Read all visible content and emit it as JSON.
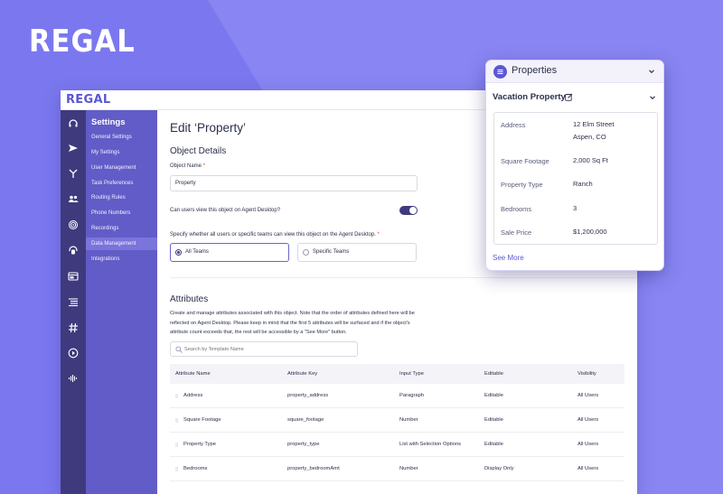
{
  "brand": {
    "name": "REGAL",
    "app_logo": "REGAL"
  },
  "colors": {
    "background": "#7b78ef",
    "accent": "#5b56d6",
    "rail": "#3f3a7e",
    "settings_nav": "#625cc8"
  },
  "rail_icons": [
    "headset-icon",
    "send-icon",
    "branch-icon",
    "team-icon",
    "fingerprint-icon",
    "support-icon",
    "browser-icon",
    "list-icon",
    "hash-icon",
    "play-icon",
    "waveform-icon"
  ],
  "settings_nav": {
    "title": "Settings",
    "items": [
      {
        "label": "General Settings"
      },
      {
        "label": "My Settings"
      },
      {
        "label": "User Management"
      },
      {
        "label": "Task Preferences"
      },
      {
        "label": "Routing Rules"
      },
      {
        "label": "Phone Numbers"
      },
      {
        "label": "Recordings"
      },
      {
        "label": "Data Management",
        "active": true
      },
      {
        "label": "Integrations"
      }
    ]
  },
  "main": {
    "title": "Edit ‘Property’",
    "object_details": {
      "heading": "Object Details",
      "name_label": "Object Name",
      "required_mark": "*",
      "name_value": "Property",
      "agent_desktop_label": "Can users view this object on Agent Desktop?",
      "agent_desktop_enabled": true,
      "visibility_label": "Specify whether all users or specific teams can view this object on the Agent Desktop.",
      "options": [
        {
          "label": "All Teams",
          "selected": true
        },
        {
          "label": "Specific Teams",
          "selected": false
        }
      ]
    },
    "attributes": {
      "heading": "Attributes",
      "description": "Create and manage attributes associated with this object. Note that the order of attributes defined here will be reflected on Agent Desktop. Please keep in mind that the first 5 attributes will be surfaced and if the object's attribute count exceeds that, the rest will be accessible by a \"See More\" button.",
      "search_placeholder": "Search by Template Name",
      "columns": [
        "Attribute Name",
        "Attribute Key",
        "Input Type",
        "Editable",
        "Visibility"
      ],
      "rows": [
        [
          "Address",
          "property_address",
          "Paragraph",
          "Editable",
          "All Users"
        ],
        [
          "Square Footage",
          "square_footage",
          "Number",
          "Editable",
          "All Users"
        ],
        [
          "Property Type",
          "property_type",
          "List with Selection Options",
          "Editable",
          "All Users"
        ],
        [
          "Bedrooms",
          "property_bedroomAmt",
          "Number",
          "Display Only",
          "All Users"
        ]
      ]
    }
  },
  "card": {
    "title": "Properties",
    "subtitle": "Vacation Property",
    "fields": [
      {
        "key": "Address",
        "value_line1": "12 Elm Street",
        "value_line2": "Aspen, CO"
      },
      {
        "key": "Square Footage",
        "value_line1": "2,000 Sq Ft"
      },
      {
        "key": "Property Type",
        "value_line1": "Ranch"
      },
      {
        "key": "Bedrooms",
        "value_line1": "3"
      },
      {
        "key": "Sale Price",
        "value_line1": "$1,200,000"
      }
    ],
    "see_more": "See More"
  }
}
